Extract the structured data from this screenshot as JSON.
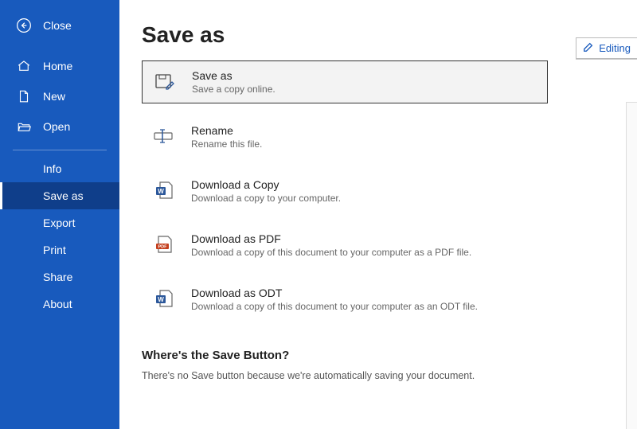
{
  "sidebar": {
    "close": "Close",
    "items1": [
      {
        "label": "Home"
      },
      {
        "label": "New"
      },
      {
        "label": "Open"
      }
    ],
    "items2": [
      {
        "label": "Info"
      },
      {
        "label": "Save as"
      },
      {
        "label": "Export"
      },
      {
        "label": "Print"
      },
      {
        "label": "Share"
      },
      {
        "label": "About"
      }
    ]
  },
  "page": {
    "title": "Save as",
    "editing": "Editing"
  },
  "options": [
    {
      "title": "Save as",
      "desc": "Save a copy online."
    },
    {
      "title": "Rename",
      "desc": "Rename this file."
    },
    {
      "title": "Download a Copy",
      "desc": "Download a copy to your computer."
    },
    {
      "title": "Download as PDF",
      "desc": "Download a copy of this document to your computer as a PDF file."
    },
    {
      "title": "Download as ODT",
      "desc": "Download a copy of this document to your computer as an ODT file."
    }
  ],
  "info": {
    "title": "Where's the Save Button?",
    "body": "There's no Save button because we're automatically saving your document."
  }
}
